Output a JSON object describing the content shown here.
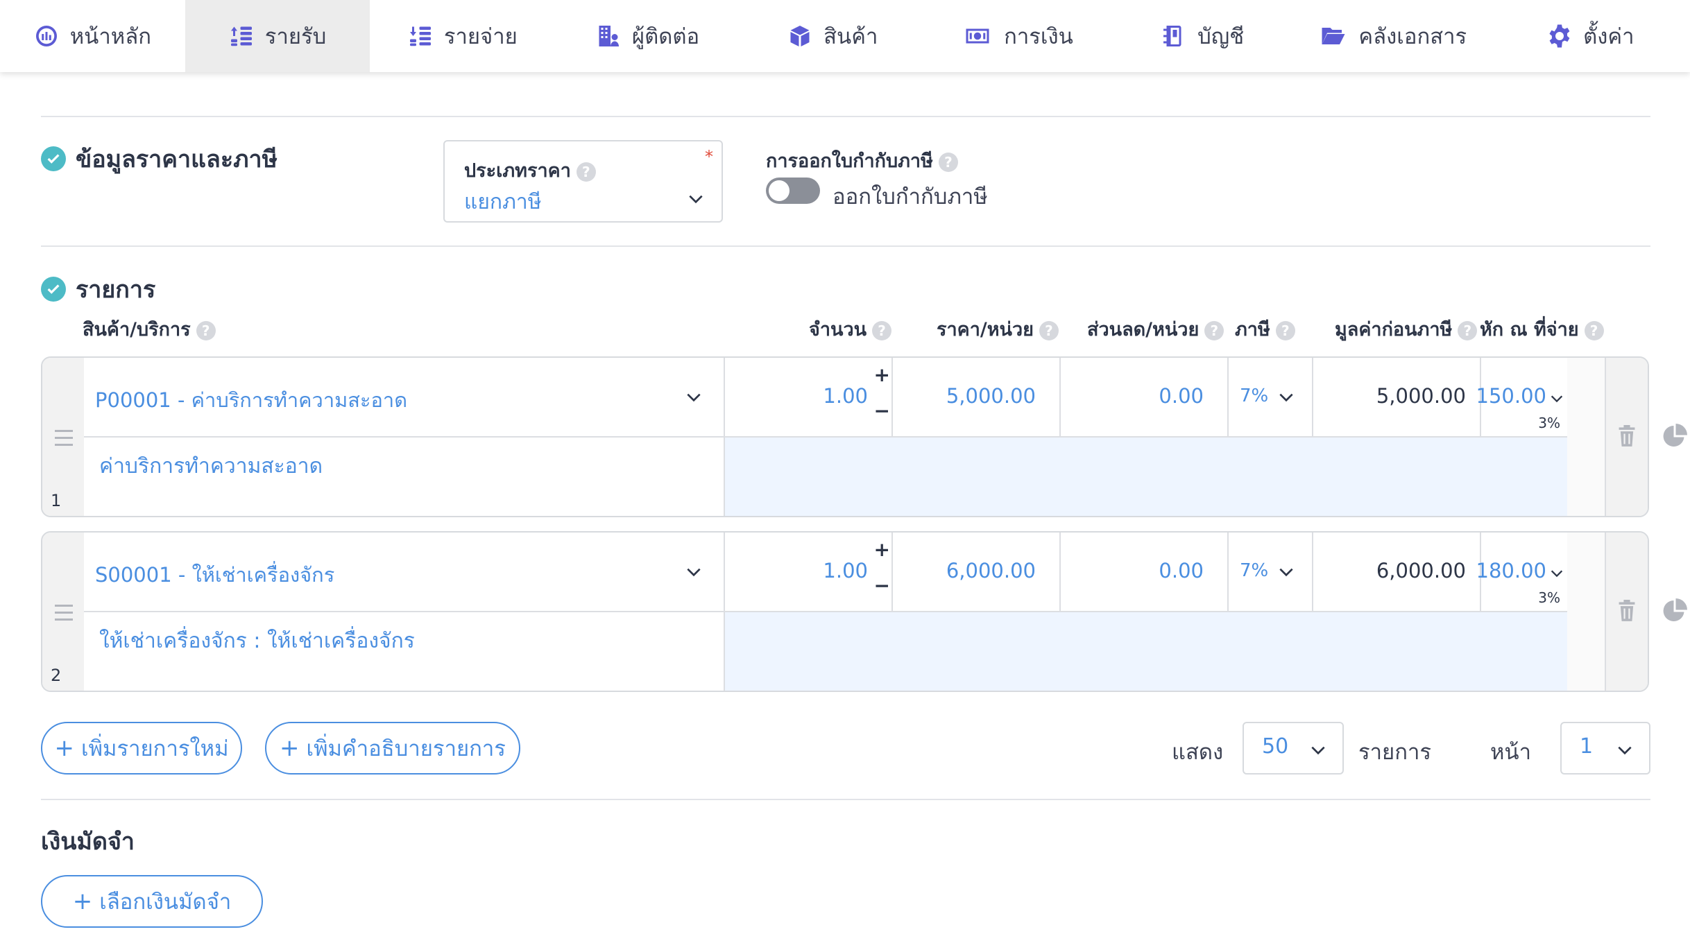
{
  "nav": {
    "items": [
      {
        "label": "หน้าหลัก",
        "icon": "dashboard-icon"
      },
      {
        "label": "รายรับ",
        "icon": "income-icon",
        "active": true
      },
      {
        "label": "รายจ่าย",
        "icon": "expense-icon"
      },
      {
        "label": "ผู้ติดต่อ",
        "icon": "contacts-icon"
      },
      {
        "label": "สินค้า",
        "icon": "box-icon"
      },
      {
        "label": "การเงิน",
        "icon": "money-icon"
      },
      {
        "label": "บัญชี",
        "icon": "ledger-icon"
      },
      {
        "label": "คลังเอกสาร",
        "icon": "folder-icon"
      },
      {
        "label": "ตั้งค่า",
        "icon": "gear-icon"
      }
    ]
  },
  "price_tax": {
    "title": "ข้อมูลราคาและภาษี",
    "price_type_label": "ประเภทราคา",
    "price_type_value": "แยกภาษี",
    "required_mark": "*",
    "tax_invoice_label": "การออกใบกำกับภาษี",
    "tax_invoice_toggle_label": "ออกใบกำกับภาษี",
    "tax_invoice_enabled": false
  },
  "items": {
    "title": "รายการ",
    "headers": {
      "product": "สินค้า/บริการ",
      "qty": "จำนวน",
      "unit_price": "ราคา/หน่วย",
      "discount": "ส่วนลด/หน่วย",
      "tax": "ภาษี",
      "pre_tax": "มูลค่าก่อนภาษี",
      "withholding": "หัก ณ ที่จ่าย"
    },
    "rows": [
      {
        "no": "1",
        "product": "P00001 - ค่าบริการทำความสะอาด",
        "qty": "1.00",
        "unit_price": "5,000.00",
        "discount": "0.00",
        "tax": "7%",
        "pre_tax": "5,000.00",
        "withholding": "150.00",
        "withholding_rate": "3%",
        "description": "ค่าบริการทำความสะอาด"
      },
      {
        "no": "2",
        "product": "S00001 - ให้เช่าเครื่องจักร",
        "qty": "1.00",
        "unit_price": "6,000.00",
        "discount": "0.00",
        "tax": "7%",
        "pre_tax": "6,000.00",
        "withholding": "180.00",
        "withholding_rate": "3%",
        "description": "ให้เช่าเครื่องจักร : ให้เช่าเครื่องจักร"
      }
    ],
    "qty_plus": "+",
    "qty_minus": "−"
  },
  "actions": {
    "add_item": "เพิ่มรายการใหม่",
    "add_description": "เพิ่มคำอธิบายรายการ",
    "plus": "+"
  },
  "pagination": {
    "show_label": "แสดง",
    "page_size": "50",
    "items_label": "รายการ",
    "page_label": "หน้า",
    "page": "1"
  },
  "deposit": {
    "title": "เงินมัดจำ",
    "select_button": "เลือกเงินมัดจำ"
  },
  "colors": {
    "accent": "#4a8ee0",
    "icon": "#5c5bd4",
    "check": "#4dbbc6"
  }
}
